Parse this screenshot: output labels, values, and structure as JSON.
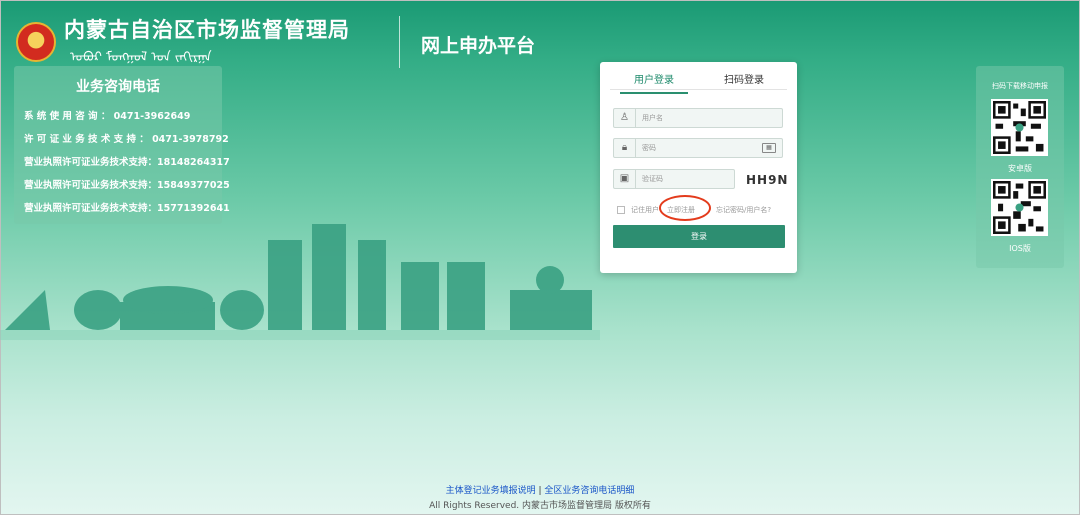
{
  "header": {
    "org_name": "内蒙古自治区市场监督管理局",
    "org_name_mongolian": "ᠣᠪᠣᠷ ᠮᠣᠩᠭᠣᠯ ᠤᠨ ᠵᠠᠬᠢᠷᠭᠠ",
    "platform_title": "网上申办平台"
  },
  "hotline": {
    "title": "业务咨询电话",
    "rows": [
      "系 统 使 用 咨 询 ： 0471-3962649",
      "许 可 证 业 务 技 术 支 持 ： 0471-3978792",
      "营业执照许可证业务技术支持：18148264317",
      "营业执照许可证业务技术支持：15849377025",
      "营业执照许可证业务技术支持：15771392641"
    ]
  },
  "login": {
    "tabs": [
      "用户登录",
      "扫码登录"
    ],
    "username_placeholder": "用户名",
    "password_placeholder": "密码",
    "captcha_placeholder": "验证码",
    "captcha_text": "HH9N",
    "remember_label": "记住用户",
    "register_label": "立即注册",
    "forgot_label": "忘记密码/用户名?",
    "submit_label": "登录"
  },
  "qr": {
    "title": "扫码下载移动申报",
    "android_label": "安卓版",
    "ios_label": "IOS版"
  },
  "footer": {
    "link1": "主体登记业务填报说明",
    "separator": "|",
    "link2": "全区业务咨询电话明细",
    "copyright": "All Rights Reserved. 内蒙古市场监督管理局 版权所有"
  },
  "colors": {
    "brand_green": "#2d8e71",
    "highlight_red": "#e33b1c",
    "link_blue": "#1a56c8"
  }
}
